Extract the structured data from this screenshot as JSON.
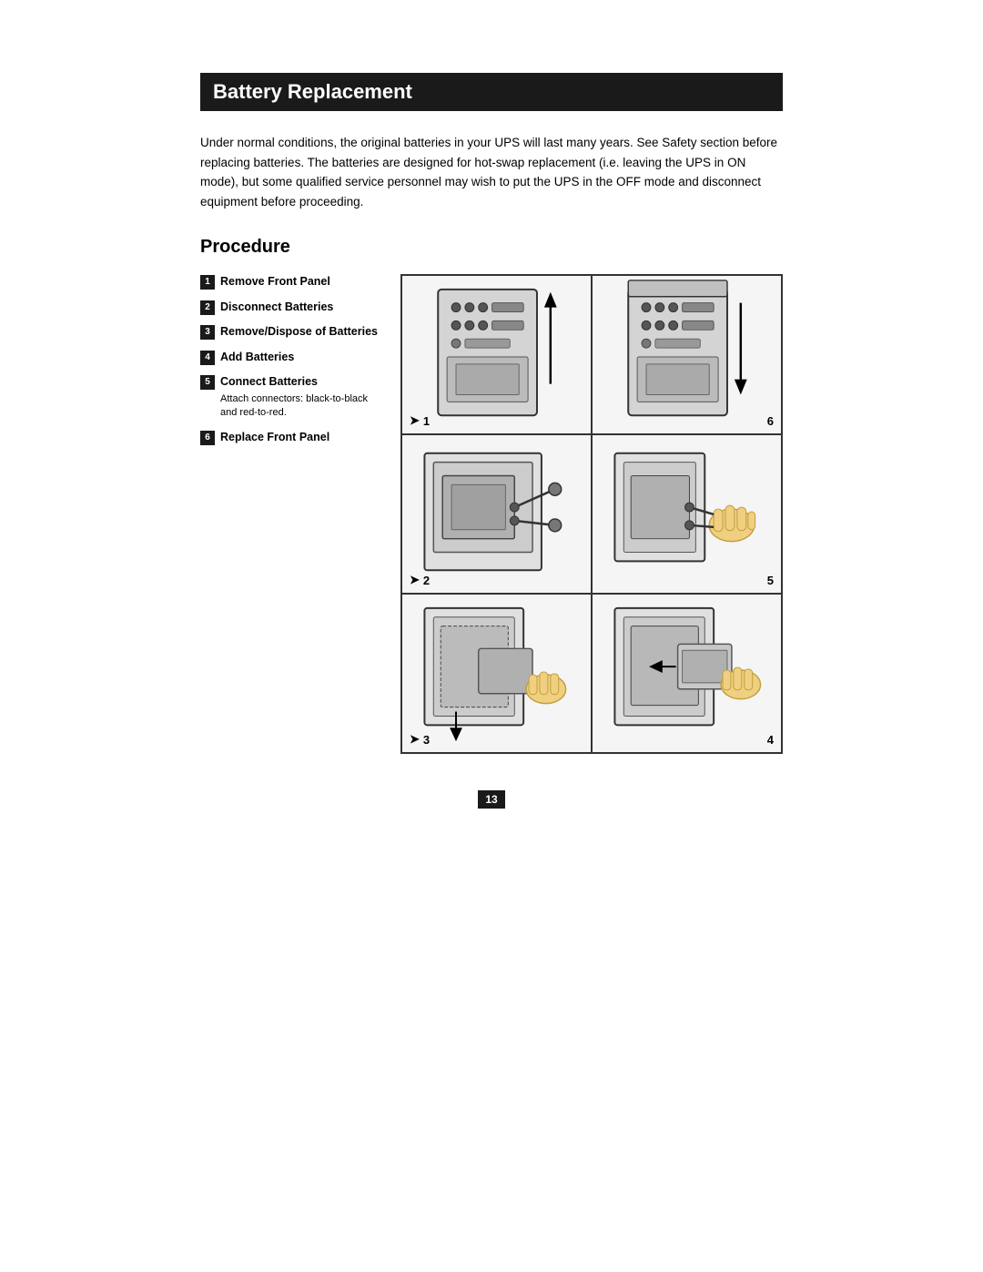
{
  "page": {
    "title": "Battery Replacement",
    "intro": "Under normal conditions, the original batteries in your UPS will last many years. See Safety section before replacing batteries. The batteries are designed for hot-swap replacement (i.e. leaving the UPS in ON mode), but some qualified service personnel may wish to put the UPS in the OFF mode and disconnect equipment before proceeding.",
    "procedure_title": "Procedure",
    "steps": [
      {
        "num": "1",
        "label": "Remove Front Panel"
      },
      {
        "num": "2",
        "label": "Disconnect Batteries"
      },
      {
        "num": "3",
        "label": "Remove/Dispose of Batteries"
      },
      {
        "num": "4",
        "label": "Add Batteries"
      },
      {
        "num": "5",
        "label": "Connect Batteries",
        "note": "Attach connectors: black-to-black and red-to-red."
      },
      {
        "num": "6",
        "label": "Replace Front Panel"
      }
    ],
    "diagram_labels": [
      "1",
      "6",
      "2",
      "5",
      "3",
      "4"
    ],
    "page_number": "13"
  }
}
